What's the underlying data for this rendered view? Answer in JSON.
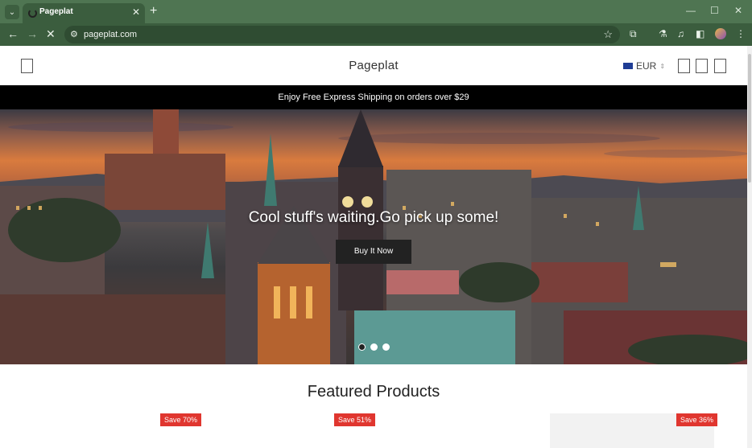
{
  "browser": {
    "tab_title": "Pageplat",
    "url": "pageplat.com",
    "icons": [
      "tab-search-icon",
      "favicon-loading-icon",
      "close-icon",
      "plus-icon",
      "minimize-icon",
      "maximize-icon",
      "window-close-icon",
      "back-arrow-icon",
      "forward-arrow-icon",
      "stop-loading-icon",
      "site-info-icon",
      "star-icon",
      "extensions-icon",
      "labs-icon",
      "media-icon",
      "side-panel-icon",
      "profile-avatar",
      "kebab-menu-icon"
    ]
  },
  "header": {
    "brand": "Pageplat",
    "currency": "EUR"
  },
  "announcement": "Enjoy Free Express Shipping on orders over $29",
  "hero": {
    "title": "Cool stuff's waiting.Go pick up some!",
    "button_label": "Buy It Now",
    "slides": 3,
    "active_slide": 1
  },
  "featured": {
    "title": "Featured Products",
    "products": [
      {
        "badge": "Save 70%"
      },
      {
        "badge": "Save 51%"
      },
      {
        "badge": "Save 36%"
      }
    ]
  },
  "colors": {
    "chrome_frame": "#4f7552",
    "chrome_toolbar": "#3b5d3e",
    "announcement_bg": "#000000",
    "badge_bg": "#e0362f"
  }
}
